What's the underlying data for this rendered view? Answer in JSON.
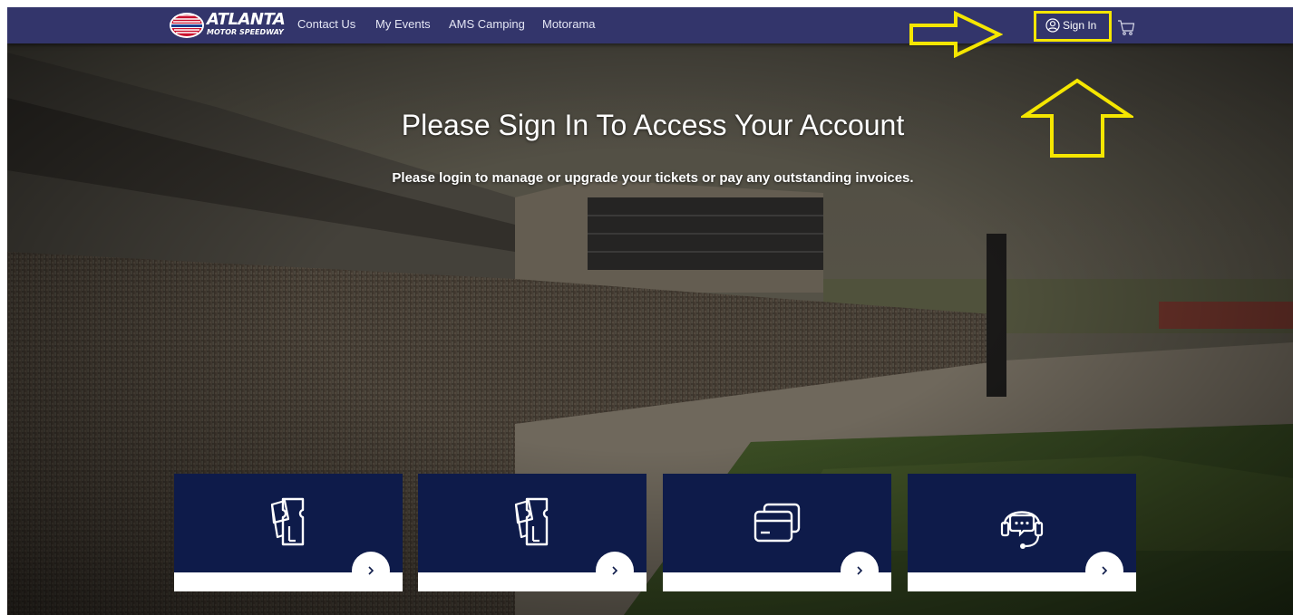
{
  "brand": {
    "name": "ATLANTA",
    "tagline": "MOTOR SPEEDWAY"
  },
  "nav": {
    "links": [
      "Contact Us",
      "My Events",
      "AMS Camping",
      "Motorama"
    ],
    "signin_label": "Sign In"
  },
  "hero": {
    "title": "Please Sign In To Access Your Account",
    "subtitle": "Please login to manage or upgrade your tickets or pay any outstanding invoices."
  },
  "cards": [
    {
      "icon": "tickets-icon"
    },
    {
      "icon": "tickets-icon"
    },
    {
      "icon": "credit-card-icon"
    },
    {
      "icon": "headset-chat-icon"
    }
  ],
  "colors": {
    "navbar": "#33356b",
    "card": "#0e1b4a",
    "annotation": "#f5e600"
  }
}
